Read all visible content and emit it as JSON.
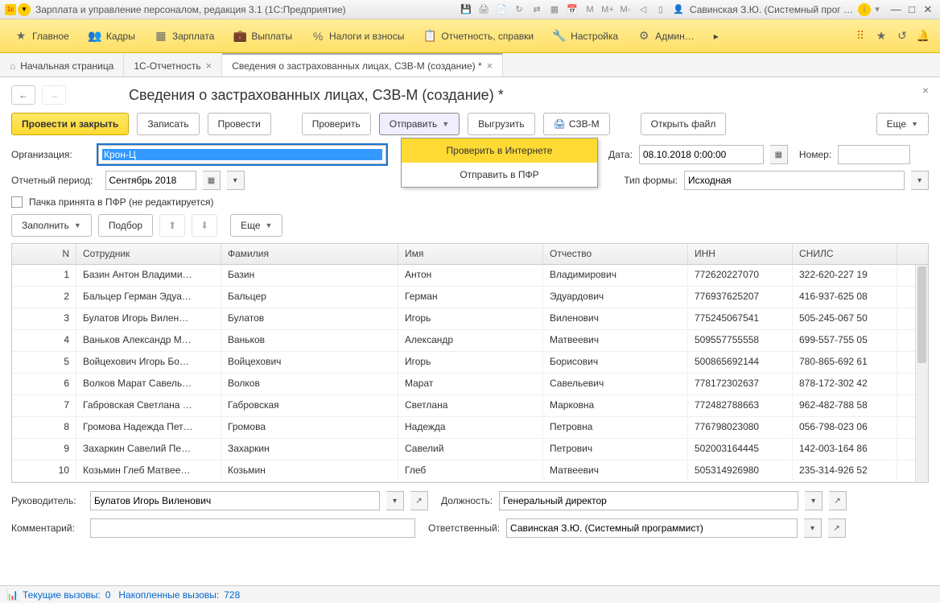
{
  "titlebar": {
    "title": "Зарплата и управление персоналом, редакция 3.1  (1С:Предприятие)",
    "user": "Савинская З.Ю. (Системный прог …",
    "info_icon": "i"
  },
  "mainmenu": {
    "items": [
      {
        "icon": "★",
        "label": "Главное"
      },
      {
        "icon": "👥",
        "label": "Кадры"
      },
      {
        "icon": "▦",
        "label": "Зарплата"
      },
      {
        "icon": "💼",
        "label": "Выплаты"
      },
      {
        "icon": "%",
        "label": "Налоги и взносы"
      },
      {
        "icon": "📋",
        "label": "Отчетность, справки"
      },
      {
        "icon": "🔧",
        "label": "Настройка"
      },
      {
        "icon": "⚙",
        "label": "Админ…"
      }
    ]
  },
  "tabs": {
    "items": [
      {
        "icon": "⌂",
        "label": "Начальная страница"
      },
      {
        "icon": "",
        "label": "1С-Отчетность"
      },
      {
        "icon": "",
        "label": "Сведения о застрахованных лицах, СЗВ-М (создание) *"
      }
    ]
  },
  "page": {
    "title": "Сведения о застрахованных лицах, СЗВ-М (создание) *"
  },
  "toolbar": {
    "post_close": "Провести и закрыть",
    "save": "Записать",
    "post": "Провести",
    "check": "Проверить",
    "send": "Отправить",
    "export": "Выгрузить",
    "szvm": "СЗВ-М",
    "openfile": "Открыть файл",
    "more": "Еще"
  },
  "dropdown": {
    "check_internet": "Проверить в Интернете",
    "send_pfr": "Отправить в ПФР"
  },
  "form": {
    "org_label": "Организация:",
    "org_value": "Крон-Ц",
    "date_label": "Дата:",
    "date_value": "08.10.2018  0:00:00",
    "number_label": "Номер:",
    "number_value": "",
    "period_label": "Отчетный период:",
    "period_value": "Сентябрь 2018",
    "formtype_label": "Тип формы:",
    "formtype_value": "Исходная",
    "pfr_checkbox": "Пачка принята в ПФР (не редактируется)",
    "fill": "Заполнить",
    "select": "Подбор",
    "more2": "Еще"
  },
  "table": {
    "headers": {
      "n": "N",
      "emp": "Сотрудник",
      "fam": "Фамилия",
      "name": "Имя",
      "pat": "Отчество",
      "inn": "ИНН",
      "snils": "СНИЛС"
    },
    "rows": [
      {
        "n": "1",
        "emp": "Базин Антон Владими…",
        "fam": "Базин",
        "name": "Антон",
        "pat": "Владимирович",
        "inn": "772620227070",
        "snils": "322-620-227 19"
      },
      {
        "n": "2",
        "emp": "Бальцер Герман Эдуа…",
        "fam": "Бальцер",
        "name": "Герман",
        "pat": "Эдуардович",
        "inn": "776937625207",
        "snils": "416-937-625 08"
      },
      {
        "n": "3",
        "emp": "Булатов Игорь Вилен…",
        "fam": "Булатов",
        "name": "Игорь",
        "pat": "Виленович",
        "inn": "775245067541",
        "snils": "505-245-067 50"
      },
      {
        "n": "4",
        "emp": "Ваньков Александр М…",
        "fam": "Ваньков",
        "name": "Александр",
        "pat": "Матвеевич",
        "inn": "509557755558",
        "snils": "699-557-755 05"
      },
      {
        "n": "5",
        "emp": "Войцехович Игорь Бо…",
        "fam": "Войцехович",
        "name": "Игорь",
        "pat": "Борисович",
        "inn": "500865692144",
        "snils": "780-865-692 61"
      },
      {
        "n": "6",
        "emp": "Волков Марат Савель…",
        "fam": "Волков",
        "name": "Марат",
        "pat": "Савельевич",
        "inn": "778172302637",
        "snils": "878-172-302 42"
      },
      {
        "n": "7",
        "emp": "Габровская Светлана …",
        "fam": "Габровская",
        "name": "Светлана",
        "pat": "Марковна",
        "inn": "772482788663",
        "snils": "962-482-788 58"
      },
      {
        "n": "8",
        "emp": "Громова Надежда Пет…",
        "fam": "Громова",
        "name": "Надежда",
        "pat": "Петровна",
        "inn": "776798023080",
        "snils": "056-798-023 06"
      },
      {
        "n": "9",
        "emp": "Захаркин Савелий Пе…",
        "fam": "Захаркин",
        "name": "Савелий",
        "pat": "Петрович",
        "inn": "502003164445",
        "snils": "142-003-164 86"
      },
      {
        "n": "10",
        "emp": "Козьмин Глеб Матвее…",
        "fam": "Козьмин",
        "name": "Глеб",
        "pat": "Матвеевич",
        "inn": "505314926980",
        "snils": "235-314-926 52"
      }
    ]
  },
  "footer": {
    "head_label": "Руководитель:",
    "head_value": "Булатов Игорь Виленович",
    "pos_label": "Должность:",
    "pos_value": "Генеральный директор",
    "comment_label": "Комментарий:",
    "comment_value": "",
    "resp_label": "Ответственный:",
    "resp_value": "Савинская З.Ю. (Системный программист)"
  },
  "status": {
    "current_label": "Текущие вызовы:",
    "current_value": "0",
    "accum_label": "Накопленные вызовы:",
    "accum_value": "728"
  }
}
